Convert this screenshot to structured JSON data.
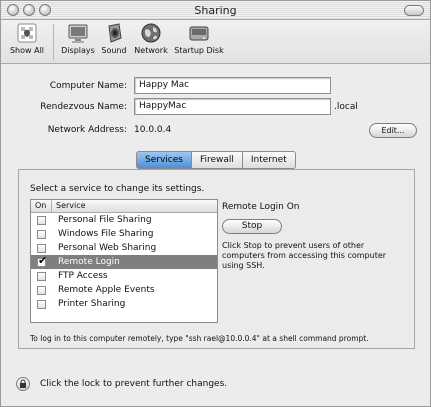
{
  "window": {
    "title": "Sharing"
  },
  "toolbar": {
    "items": [
      {
        "label": "Show All",
        "icon": "apple-icon"
      },
      {
        "label": "Displays",
        "icon": "display-icon"
      },
      {
        "label": "Sound",
        "icon": "speaker-icon"
      },
      {
        "label": "Network",
        "icon": "globe-icon"
      },
      {
        "label": "Startup Disk",
        "icon": "disk-icon"
      }
    ]
  },
  "form": {
    "computer_name_label": "Computer Name:",
    "computer_name_value": "Happy Mac",
    "rendezvous_label": "Rendezvous Name:",
    "rendezvous_value": "HappyMac",
    "rendezvous_suffix": ".local",
    "network_address_label": "Network Address:",
    "network_address_value": "10.0.0.4",
    "edit_button": "Edit..."
  },
  "tabs": [
    {
      "label": "Services",
      "active": true
    },
    {
      "label": "Firewall",
      "active": false
    },
    {
      "label": "Internet",
      "active": false
    }
  ],
  "services": {
    "prompt": "Select a service to change its settings.",
    "header_on": "On",
    "header_service": "Service",
    "items": [
      {
        "name": "Personal File Sharing",
        "on": false,
        "selected": false
      },
      {
        "name": "Windows File Sharing",
        "on": false,
        "selected": false
      },
      {
        "name": "Personal Web Sharing",
        "on": false,
        "selected": false
      },
      {
        "name": "Remote Login",
        "on": true,
        "selected": true
      },
      {
        "name": "FTP Access",
        "on": false,
        "selected": false
      },
      {
        "name": "Remote Apple Events",
        "on": false,
        "selected": false
      },
      {
        "name": "Printer Sharing",
        "on": false,
        "selected": false
      }
    ],
    "status_title": "Remote Login On",
    "stop_button": "Stop",
    "status_description": "Click Stop to prevent users of other computers from accessing this computer using SSH.",
    "remote_hint": "To log in to this computer remotely, type \"ssh rael@10.0.0.4\" at a shell command prompt."
  },
  "lock": {
    "text": "Click the lock to prevent further changes.",
    "icon": "lock-icon"
  },
  "colors": {
    "selection": "#7f7f7f",
    "active_tab": "#5b97dc"
  }
}
